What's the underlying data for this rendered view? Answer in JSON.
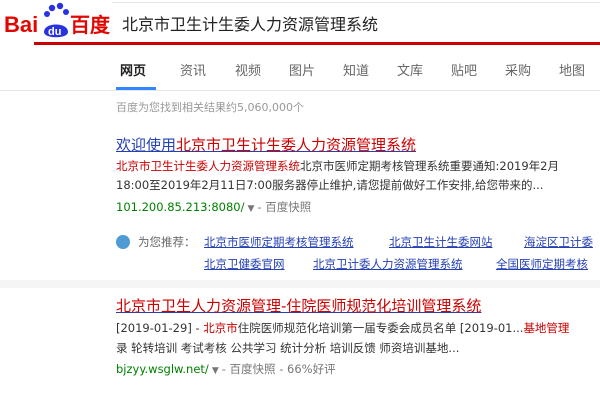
{
  "search": {
    "query": "北京市卫生计生委人力资源管理系统"
  },
  "logo": {
    "text_left": "Bai",
    "text_paw": "du",
    "text_right": "百度"
  },
  "tabs": [
    {
      "label": "网页",
      "active": true
    },
    {
      "label": "资讯"
    },
    {
      "label": "视频"
    },
    {
      "label": "图片"
    },
    {
      "label": "知道"
    },
    {
      "label": "文库"
    },
    {
      "label": "贴吧"
    },
    {
      "label": "采购"
    },
    {
      "label": "地图"
    }
  ],
  "meta": {
    "result_count": "百度为您找到相关结果约5,060,000个"
  },
  "results": [
    {
      "title_prefix": "欢迎使用",
      "title_em": "北京市卫生计生委人力资源管理系统",
      "snippet1_em": "北京市卫生计生委人力资源管理系统",
      "snippet1_rest": "北京市医师定期考核管理系统重要通知:2019年2月",
      "snippet2": "18:00至2019年2月11日7:00服务器停止维护,请您提前做好工作安排,给您带来的...",
      "url": "101.200.85.213:8080/",
      "dropdown": "▼",
      "sep": "-",
      "cache": "百度快照",
      "rec_label": "为您推荐：",
      "rec_links": [
        "北京市医师定期考核管理系统",
        "北京卫生计生委网站",
        "海淀区卫计委",
        "北京卫健委官网",
        "北京卫计委人力资源管理系统",
        "全国医师定期考核"
      ]
    },
    {
      "title_em": "北京市卫生人力资源管理",
      "title_rest": "-住院医师规范化培训管理系统",
      "snippet1_date": "[2019-01-29]",
      "snippet1_sep": " - ",
      "snippet1_em": "北京市",
      "snippet1_rest": "住院医师规范化培训第一届专委会成员名单 [2019-01...",
      "snippet1_tail": "基地管理",
      "snippet2": "录 轮转培训 考试考核 公共学习 统计分析 培训反馈 师资培训基地...",
      "url": "bjzyy.wsglw.net/",
      "dropdown": "▼",
      "sep": "-",
      "cache": "百度快照",
      "sep2": "-",
      "rating": "66%好评"
    }
  ],
  "colors": {
    "accent_blue": "#2440b3",
    "highlight_red": "#cc0000",
    "url_green": "#008000",
    "tab_active": "#3385ff"
  }
}
